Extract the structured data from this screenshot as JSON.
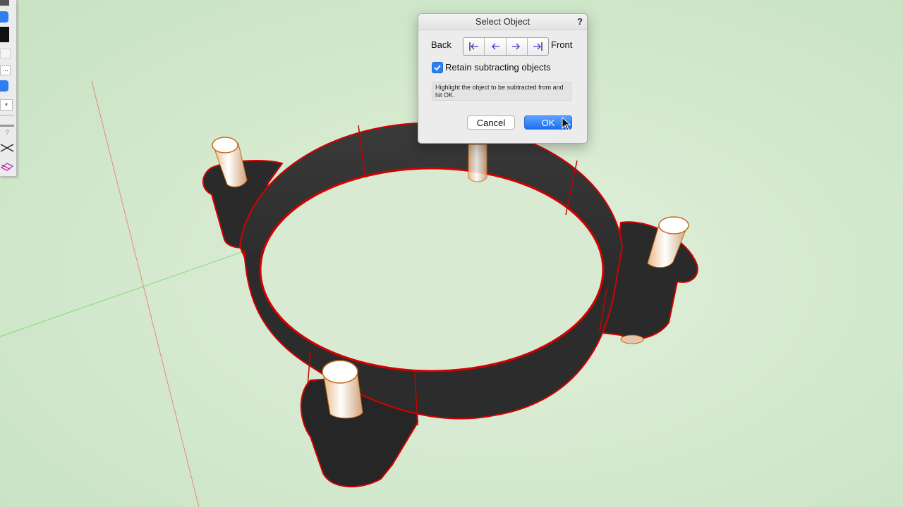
{
  "dialog": {
    "title": "Select Object",
    "help": "?",
    "back_label": "Back",
    "front_label": "Front",
    "nav_buttons": [
      "first-icon",
      "previous-icon",
      "next-icon",
      "last-icon"
    ],
    "retain_label": "Retain subtracting objects",
    "retain_checked": true,
    "hint": "Highlight the object to be subtracted from and hit OK.",
    "cancel_label": "Cancel",
    "ok_label": "OK"
  },
  "palette": {
    "icons": [
      "color-swatch-icon",
      "dropdown-icon",
      "dropdown-icon",
      "help-icon",
      "x-axis-icon",
      "plane-icon"
    ],
    "help": "?"
  },
  "colors": {
    "accent": "#2d7ff3",
    "selection_edge": "#e00000",
    "solid_fill": "#2c2c2c",
    "pin": "#f2ede6"
  }
}
